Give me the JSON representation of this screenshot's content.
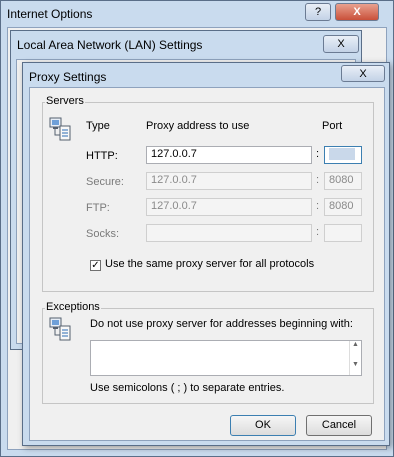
{
  "outer_window": {
    "title": "Internet Options",
    "help": "?",
    "close": "X"
  },
  "lan_window": {
    "title": "Local Area Network (LAN) Settings",
    "close": "X"
  },
  "proxy_window": {
    "title": "Proxy Settings",
    "close": "X"
  },
  "servers": {
    "group_label": "Servers",
    "col_type": "Type",
    "col_address": "Proxy address to use",
    "col_port": "Port",
    "rows": [
      {
        "type": "HTTP:",
        "address": "127.0.0.7",
        "sep": ":",
        "port": ""
      },
      {
        "type": "Secure:",
        "address": "127.0.0.7",
        "sep": ":",
        "port": "8080"
      },
      {
        "type": "FTP:",
        "address": "127.0.0.7",
        "sep": ":",
        "port": "8080"
      },
      {
        "type": "Socks:",
        "address": "",
        "sep": ":",
        "port": ""
      }
    ],
    "same_proxy_label": "Use the same proxy server for all protocols",
    "same_proxy_checked": true
  },
  "exceptions": {
    "group_label": "Exceptions",
    "description": "Do not use proxy server for addresses beginning with:",
    "value": "",
    "hint": "Use semicolons ( ; ) to separate entries."
  },
  "buttons": {
    "ok": "OK",
    "cancel": "Cancel"
  },
  "check_mark": "✓",
  "colors": {
    "title_bar": "#c9dbee",
    "dialog_bg": "#f0f0f0",
    "close_red": "#c9503a"
  }
}
